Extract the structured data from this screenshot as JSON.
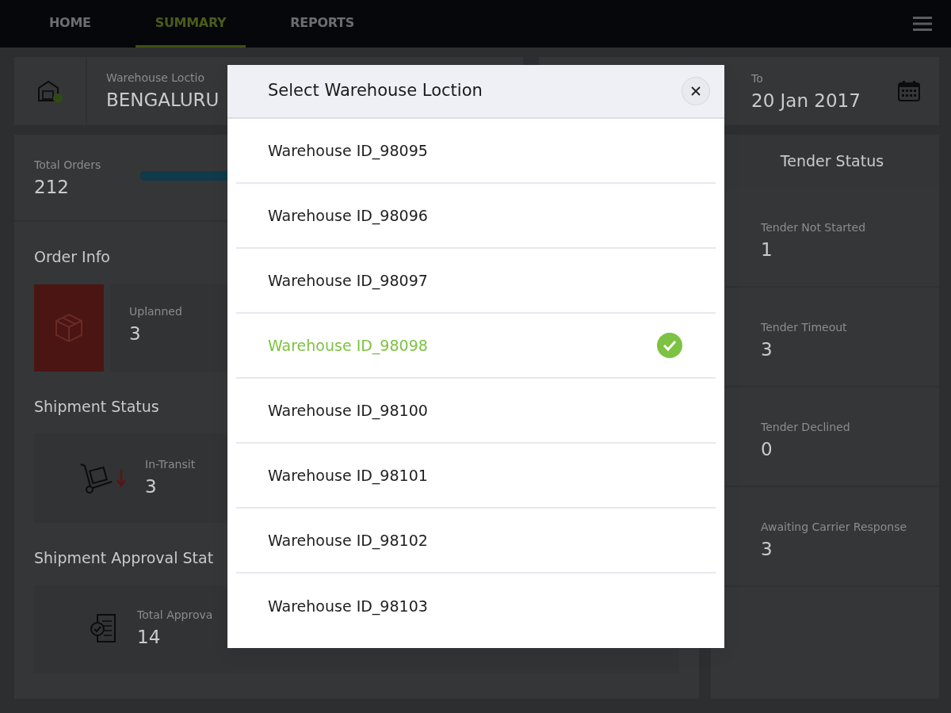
{
  "nav": {
    "tabs": [
      {
        "label": "HOME",
        "selected": false
      },
      {
        "label": "SUMMARY",
        "selected": true
      },
      {
        "label": "REPORTS",
        "selected": false
      }
    ]
  },
  "location": {
    "label": "Warehouse Loctio",
    "value": "BENGALURU"
  },
  "date_to": {
    "label": "To",
    "value": "20 Jan 2017"
  },
  "total_orders": {
    "label": "Total Orders",
    "value": "212",
    "level": 1
  },
  "order_info": {
    "title": "Order Info",
    "stats": [
      {
        "label": "Uplanned",
        "value": "3"
      }
    ]
  },
  "shipment_status": {
    "title": "Shipment Status",
    "stats": [
      {
        "label": "In-Transit",
        "value": "3"
      }
    ]
  },
  "shipment_approval": {
    "title": "Shipment Approval Stat",
    "stats": [
      {
        "label": "Total Approva",
        "value": "14"
      }
    ]
  },
  "tender": {
    "title": "Tender Status",
    "items": [
      {
        "label": "Tender Not Started",
        "value": "1"
      },
      {
        "label": "Tender Timeout",
        "value": "3"
      },
      {
        "label": "Tender Declined",
        "value": "0"
      },
      {
        "label": "Awaiting Carrier Response",
        "value": "3"
      }
    ]
  },
  "modal": {
    "title": "Select Warehouse Loction",
    "items": [
      {
        "label": "Warehouse ID_98095",
        "selected": false
      },
      {
        "label": "Warehouse ID_98096",
        "selected": false
      },
      {
        "label": "Warehouse ID_98097",
        "selected": false
      },
      {
        "label": "Warehouse ID_98098",
        "selected": true
      },
      {
        "label": "Warehouse ID_98100",
        "selected": false
      },
      {
        "label": "Warehouse ID_98101",
        "selected": false
      },
      {
        "label": "Warehouse ID_98102",
        "selected": false
      },
      {
        "label": "Warehouse ID_98103",
        "selected": false
      }
    ]
  }
}
